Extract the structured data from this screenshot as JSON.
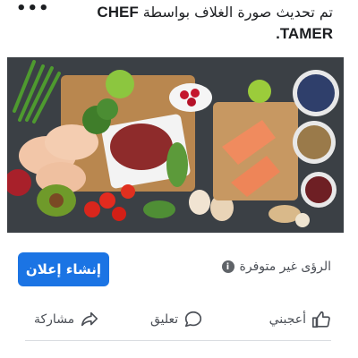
{
  "post": {
    "more_label": "•••",
    "text_arabic": "تم تحديث صورة الغلاف بواسطة",
    "text_name": "CHEF TAMER."
  },
  "image": {
    "icon": "food-photo"
  },
  "ad": {
    "create_ad_label": "إنشاء إعلان",
    "insights_text": "الرؤى غير متوفرة",
    "info_icon_glyph": "i"
  },
  "actions": {
    "like_label": "أعجبني",
    "comment_label": "تعليق",
    "share_label": "مشاركة"
  },
  "colors": {
    "primary_button": "#1b74e4",
    "text": "#1c1e21",
    "secondary_text": "#4b4f56"
  }
}
